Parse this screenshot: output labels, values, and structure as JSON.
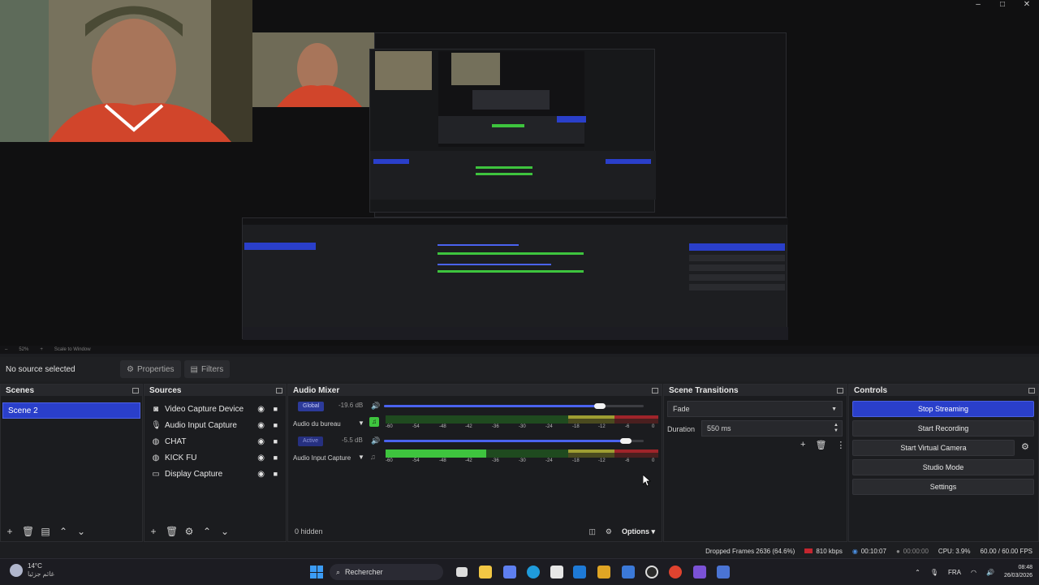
{
  "colors": {
    "accent": "#2a3fca",
    "panel": "#1b1c1f",
    "header": "#27282c",
    "meter_green": "#3ec43e",
    "meter_yellow": "#c2c13b",
    "meter_red": "#c3262f"
  },
  "window_controls": [
    "–",
    "□",
    "✕"
  ],
  "preview": {
    "zoom": "52%",
    "scale_label": "Scale to Window"
  },
  "context_bar": {
    "no_source": "No source selected",
    "properties": "Properties",
    "filters": "Filters"
  },
  "scenes": {
    "title": "Scenes",
    "items": [
      "Scene 2"
    ]
  },
  "sources": {
    "title": "Sources",
    "items": [
      {
        "label": "Video Capture Device",
        "icon": "camera-icon"
      },
      {
        "label": "Audio Input Capture",
        "icon": "microphone-icon"
      },
      {
        "label": "CHAT",
        "icon": "globe-icon"
      },
      {
        "label": "KICK FU",
        "icon": "globe-icon"
      },
      {
        "label": "Display Capture",
        "icon": "monitor-icon"
      }
    ]
  },
  "mixer": {
    "title": "Audio Mixer",
    "channels": [
      {
        "name": "Audio du bureau",
        "badge": "Global",
        "db": "-19.6 dB",
        "volume_fraction": 0.83,
        "level_fraction": 0.0
      },
      {
        "name": "Audio Input Capture",
        "badge": "Active",
        "db": "-5.5 dB",
        "volume_fraction": 0.93,
        "level_fraction": 0.37
      }
    ],
    "ticks": [
      "-60",
      "-54",
      "-48",
      "-42",
      "-36",
      "-30",
      "-24",
      "-18",
      "-12",
      "-6",
      "0"
    ],
    "hidden_label": "0 hidden",
    "options_label": "Options"
  },
  "transitions": {
    "title": "Scene Transitions",
    "selected": "Fade",
    "duration_label": "Duration",
    "duration_value": "550 ms"
  },
  "controls": {
    "title": "Controls",
    "buttons": [
      "Stop Streaming",
      "Start Recording",
      "Start Virtual Camera",
      "Studio Mode",
      "Settings"
    ]
  },
  "status": {
    "dropped": "Dropped Frames 2636 (64.6%)",
    "bitrate": "810 kbps",
    "stream_time": "00:10:07",
    "rec_time": "00:00:00",
    "cpu": "CPU: 3.9%",
    "fps": "60.00 / 60.00 FPS"
  },
  "taskbar": {
    "weather_temp": "14°C",
    "weather_desc": "غائم جزئيا",
    "search": "Rechercher",
    "lang": "FRA",
    "time": "08:48",
    "date": "26/03/2026"
  }
}
